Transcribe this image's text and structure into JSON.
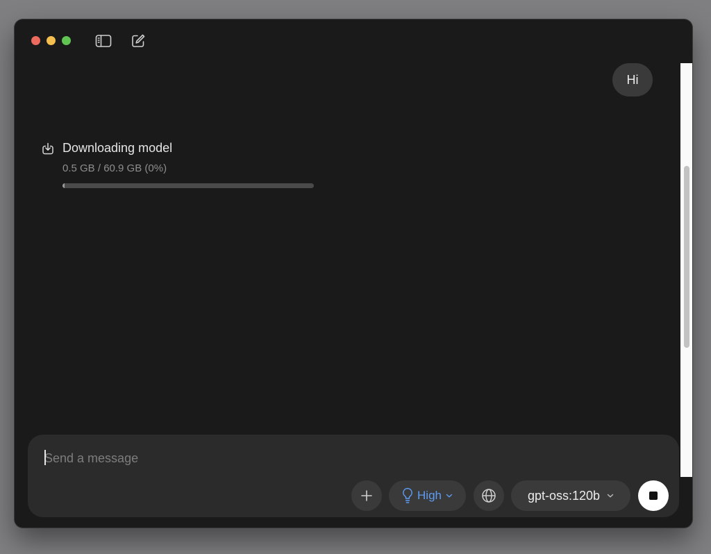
{
  "chat": {
    "user_message": "Hi"
  },
  "download": {
    "title": "Downloading model",
    "progress_text": "0.5 GB / 60.9 GB (0%)",
    "progress_fraction": 0.008
  },
  "composer": {
    "placeholder": "Send a message",
    "value": "",
    "thinking_level": "High",
    "model": "gpt-oss:120b"
  },
  "colors": {
    "accent": "#5d9cf2",
    "background": "#1a1a1a",
    "composer": "#2b2b2b"
  },
  "icons": {
    "sidebar_toggle": "sidebar-icon",
    "new_chat": "compose-icon",
    "download": "download-icon",
    "add": "plus-icon",
    "thinking": "lightbulb-icon",
    "web": "globe-icon",
    "model_dropdown": "chevron-down-icon",
    "stop": "stop-icon"
  }
}
